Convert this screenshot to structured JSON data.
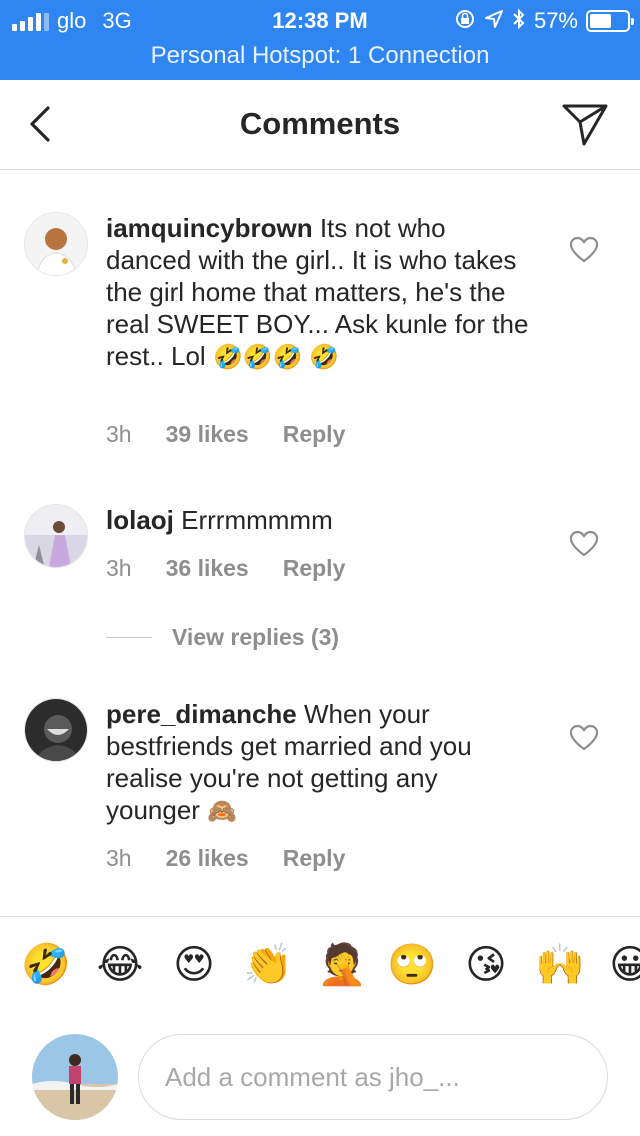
{
  "status_bar": {
    "carrier": "glo",
    "network": "3G",
    "time": "12:38 PM",
    "battery": "57%",
    "battery_level": 0.57,
    "hotspot": "Personal Hotspot: 1 Connection"
  },
  "header": {
    "title": "Comments"
  },
  "comments": [
    {
      "username": "iamquincybrown",
      "text": "Its not who danced with the girl.. It is who takes the girl home that matters, he's the real SWEET BOY... Ask kunle for the rest.. Lol",
      "emojis": "🤣🤣🤣 🤣",
      "time": "3h",
      "likes": "39 likes",
      "reply": "Reply"
    },
    {
      "username": "lolaoj",
      "text": "Errrmmmmm",
      "emojis": "",
      "time": "3h",
      "likes": "36 likes",
      "reply": "Reply"
    },
    {
      "username": "pere_dimanche",
      "text": "When your bestfriends get married and you realise you're not getting any younger",
      "emojis": "🙈",
      "time": "3h",
      "likes": "26 likes",
      "reply": "Reply"
    }
  ],
  "view_replies": "View replies (3)",
  "emoji_bar": [
    "🤣",
    "😂",
    "😍",
    "👏",
    "🤦",
    "🙄",
    "😘",
    "🙌",
    "😀"
  ],
  "compose": {
    "placeholder": "Add a comment as jho_..."
  },
  "colors": {
    "status_bar": "#2f86f3",
    "text": "#262626",
    "secondary_text": "#8e8e8e",
    "divider": "#dbdbdb"
  },
  "icons": [
    "signal-icon",
    "orientation-lock-icon",
    "location-icon",
    "bluetooth-icon",
    "battery-icon",
    "back-icon",
    "direct-send-icon",
    "heart-icon"
  ]
}
